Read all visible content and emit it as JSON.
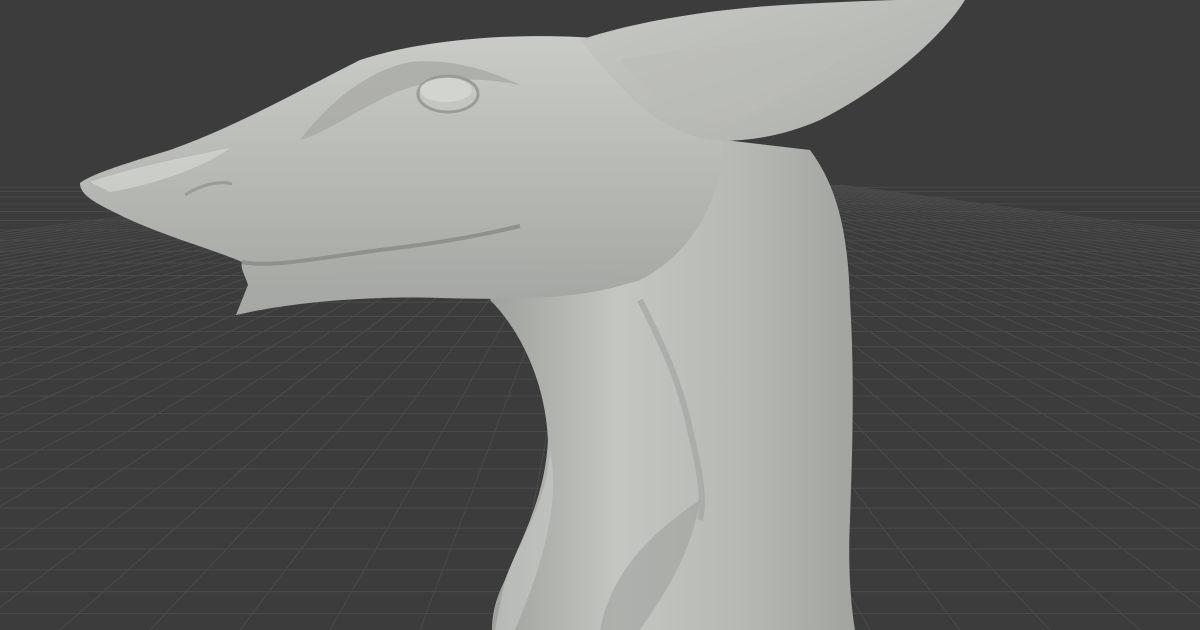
{
  "viewport": {
    "background_color": "#3c3c3c",
    "grid_color": "#4a4a4a",
    "model_color": "#b4b6b2",
    "model_highlight_color": "#cfd1cd",
    "model_shadow_color": "#8d8f8b"
  }
}
